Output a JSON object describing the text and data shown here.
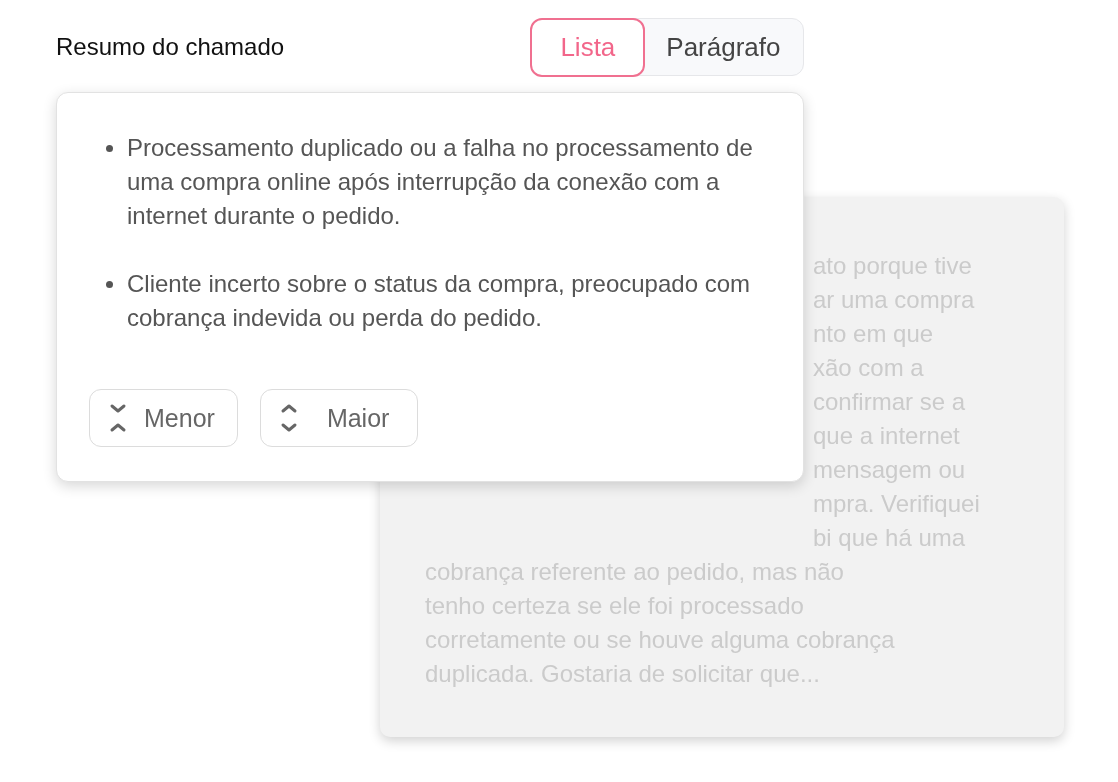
{
  "header": {
    "title": "Resumo do chamado"
  },
  "view_toggle": [
    {
      "label": "Lista",
      "selected": true
    },
    {
      "label": "Parágrafo",
      "selected": false
    }
  ],
  "background_card": {
    "partial_lines": [
      "ato porque tive",
      "ar uma compra",
      "nto em que",
      "xão com a",
      "confirmar se a",
      "que a internet",
      "mensagem ou",
      "mpra. Verifiquei",
      "bi que há uma"
    ],
    "full_lines": [
      "cobrança referente ao pedido, mas não",
      "tenho certeza se ele foi processado",
      "corretamente ou se houve alguma cobrança",
      "duplicada. Gostaria de solicitar que..."
    ]
  },
  "summary_card": {
    "bullets": [
      "Processamento duplicado ou a falha no processamento de uma compra online após interrupção da conexão com a internet durante o pedido.",
      "Cliente incerto sobre o status da compra, preocupado com cobrança indevida ou perda do pedido."
    ],
    "buttons": [
      {
        "label": "Menor",
        "kind": "shorter"
      },
      {
        "label": "Maior",
        "kind": "longer"
      }
    ]
  }
}
